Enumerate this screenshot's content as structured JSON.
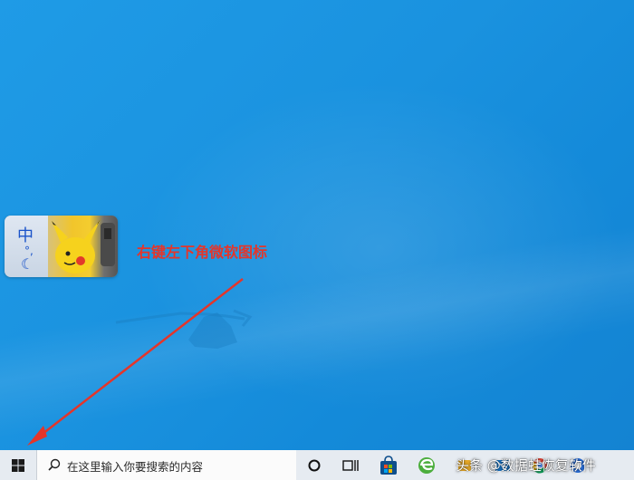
{
  "annotation": {
    "text": "右键左下角微软图标"
  },
  "ime": {
    "mode_char": "中",
    "punct": "°,",
    "moon": "☾"
  },
  "taskbar": {
    "search_placeholder": "在这里输入你要搜索的内容",
    "items": [
      {
        "name": "cortana-icon"
      },
      {
        "name": "task-view-icon"
      },
      {
        "name": "store-icon"
      },
      {
        "name": "edge-icon"
      }
    ],
    "watermark": "头条 @数据蛙恢复软件"
  },
  "colors": {
    "accent_red": "#e5352a",
    "desktop_blue": "#1a92df",
    "taskbar": "#e6ebf1"
  }
}
